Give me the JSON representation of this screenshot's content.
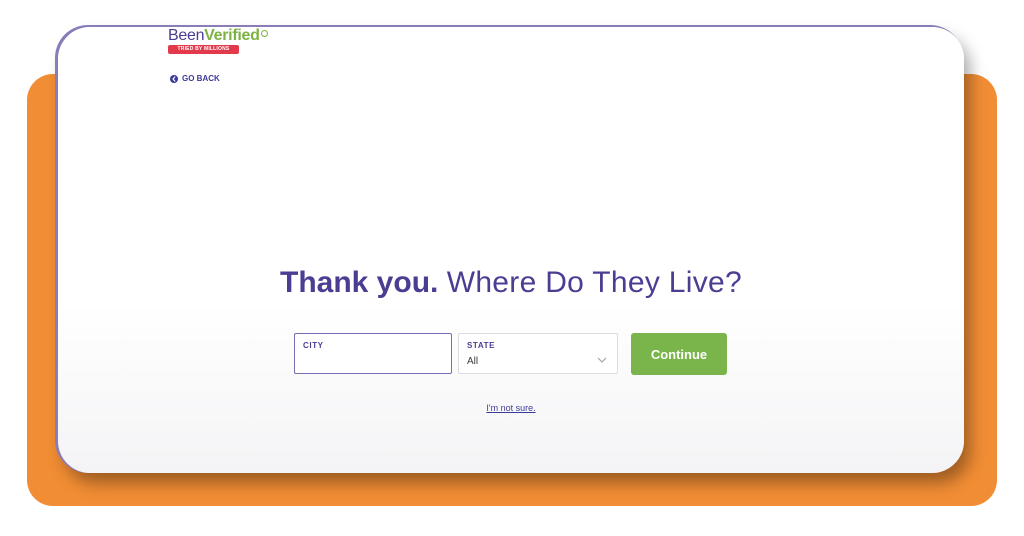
{
  "brand": {
    "name_part1": "Been",
    "name_part2": "Verified",
    "tagline": "TRIED BY MILLIONS",
    "primary_color": "#4b3d92",
    "accent_color": "#7cb342",
    "tagline_color": "#e23a4a"
  },
  "nav": {
    "back_label": "GO BACK",
    "back_icon": "chevron-left-circle-icon"
  },
  "headline": {
    "bold": "Thank you.",
    "light": "Where Do They Live?"
  },
  "form": {
    "city": {
      "label": "CITY",
      "value": ""
    },
    "state": {
      "label": "STATE",
      "value": "All",
      "icon": "chevron-down-icon"
    },
    "continue_label": "Continue",
    "continue_color": "#79b54a",
    "not_sure_label": "I'm not sure."
  },
  "colors": {
    "frame_orange": "#f18d34"
  }
}
